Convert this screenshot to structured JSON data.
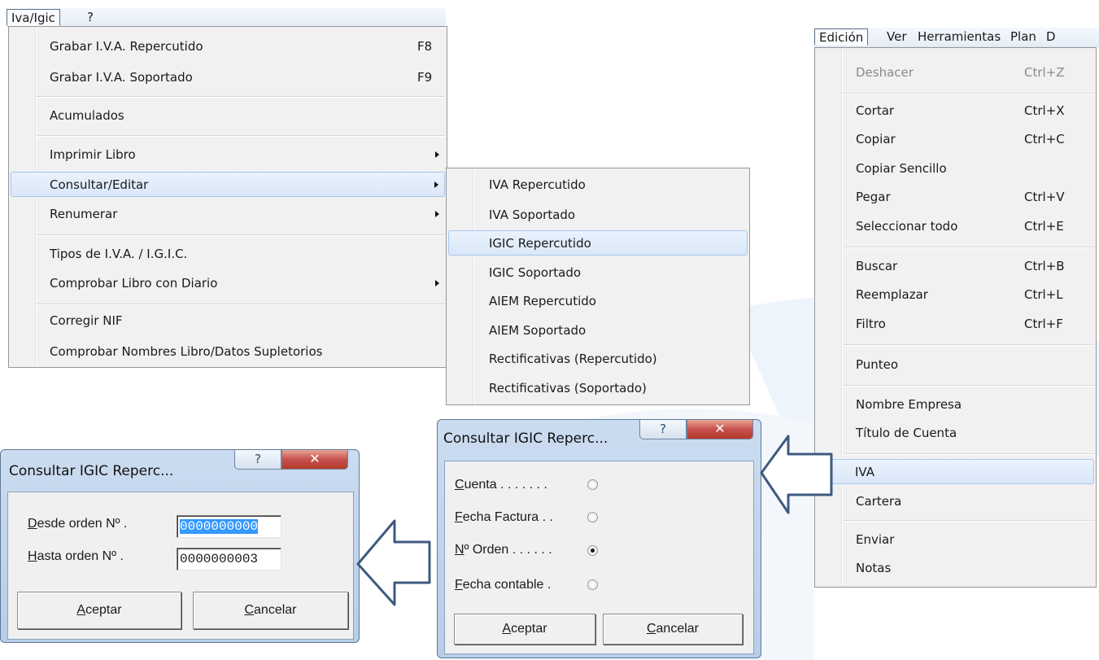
{
  "left_menubar": {
    "items": [
      "Iva/Igic",
      "?"
    ]
  },
  "iva_menu": {
    "items": [
      {
        "label": "Grabar I.V.A. Repercutido",
        "shortcut": "F8"
      },
      {
        "label": "Grabar I.V.A. Soportado",
        "shortcut": "F9"
      },
      {
        "label": "Acumulados"
      },
      {
        "label": "Imprimir Libro",
        "submenu": true
      },
      {
        "label": "Consultar/Editar",
        "submenu": true,
        "highlighted": true
      },
      {
        "label": "Renumerar",
        "submenu": true
      },
      {
        "label": "Tipos de I.V.A. / I.G.I.C."
      },
      {
        "label": "Comprobar Libro con Diario",
        "submenu": true
      },
      {
        "label": "Corregir NIF"
      },
      {
        "label": "Comprobar Nombres Libro/Datos Supletorios"
      }
    ]
  },
  "consultar_submenu": {
    "items": [
      "IVA Repercutido",
      "IVA Soportado",
      "IGIC Repercutido",
      "IGIC Soportado",
      "AIEM Repercutido",
      "AIEM Soportado",
      "Rectificativas (Repercutido)",
      "Rectificativas (Soportado)"
    ],
    "highlighted": "IGIC Repercutido"
  },
  "right_menubar": {
    "items": [
      "Edición",
      "Ver",
      "Herramientas",
      "Plan",
      "D"
    ]
  },
  "edicion_menu": {
    "items": [
      {
        "label": "Deshacer",
        "shortcut": "Ctrl+Z",
        "disabled": true
      },
      {
        "label": "Cortar",
        "shortcut": "Ctrl+X"
      },
      {
        "label": "Copiar",
        "shortcut": "Ctrl+C"
      },
      {
        "label": "Copiar Sencillo",
        "shortcut": ""
      },
      {
        "label": "Pegar",
        "shortcut": "Ctrl+V"
      },
      {
        "label": "Seleccionar todo",
        "shortcut": "Ctrl+E"
      },
      {
        "label": "Buscar",
        "shortcut": "Ctrl+B"
      },
      {
        "label": "Reemplazar",
        "shortcut": "Ctrl+L"
      },
      {
        "label": "Filtro",
        "shortcut": "Ctrl+F"
      },
      {
        "label": "Punteo"
      },
      {
        "label": "Nombre Empresa"
      },
      {
        "label": "Título de Cuenta"
      },
      {
        "label": "IVA",
        "highlighted": true
      },
      {
        "label": "Cartera"
      },
      {
        "label": "Enviar"
      },
      {
        "label": "Notas"
      }
    ]
  },
  "dialog_order": {
    "title": "Consultar  IGIC Reperc...",
    "options": [
      {
        "label": "Cuenta . . . . . . .",
        "accel": "C",
        "rest": "uenta . . . . . . .",
        "selected": false
      },
      {
        "label": "Fecha Factura . .",
        "accel": "F",
        "rest": "echa Factura . .",
        "selected": false
      },
      {
        "label": "Nº Orden . . . . . .",
        "accel": "N",
        "rest": "º Orden . . . . . .",
        "selected": true
      },
      {
        "label": "Fecha contable .",
        "accel": "F",
        "rest": "echa contable .",
        "selected": false
      }
    ],
    "ok_accel": "A",
    "ok_rest": "ceptar",
    "cancel_accel": "C",
    "cancel_rest": "ancelar"
  },
  "dialog_range": {
    "title": "Consultar  IGIC Reperc...",
    "from_accel": "D",
    "from_rest": "esde orden Nº .",
    "to_accel": "H",
    "to_rest": "asta orden Nº  .",
    "from_value": "0000000000",
    "to_value": "0000000003",
    "ok_accel": "A",
    "ok_rest": "ceptar",
    "cancel_accel": "C",
    "cancel_rest": "ancelar"
  },
  "colors": {
    "menu_bg": "#f1f1f1",
    "highlight": "#dae7f8",
    "arrow_stroke": "#3e5a80",
    "dialog_frame": "#b7cde8"
  }
}
